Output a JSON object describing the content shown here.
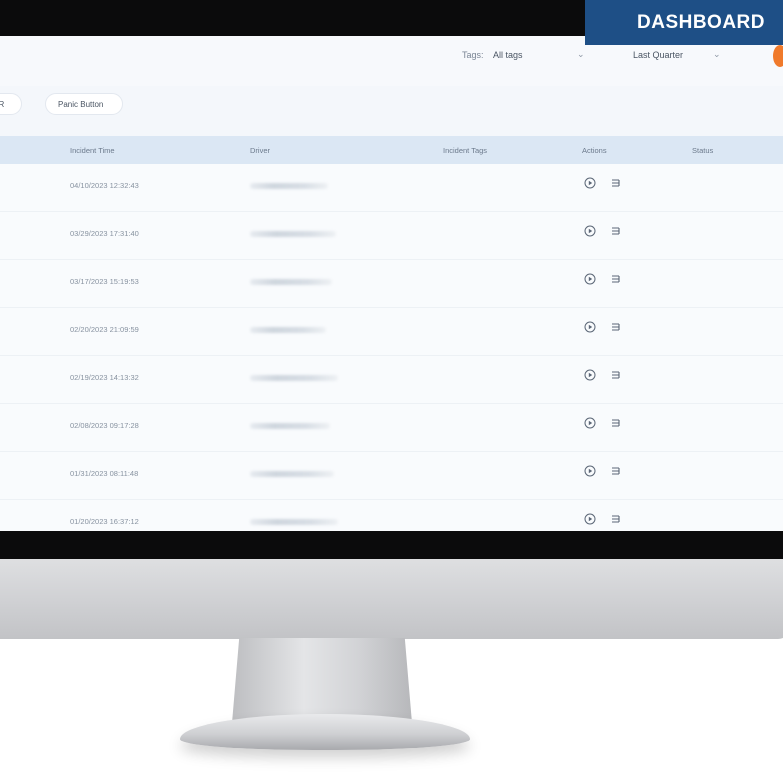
{
  "banner": {
    "title": "DASHBOARD"
  },
  "toolbar": {
    "tags_label": "Tags:",
    "tags_value": "All tags",
    "period_value": "Last Quarter"
  },
  "filters": {
    "chips": [
      "WR",
      "Panic Button"
    ]
  },
  "table": {
    "headers": {
      "incident_time": "Incident Time",
      "driver": "Driver",
      "incident_tags": "Incident Tags",
      "actions": "Actions",
      "status": "Status"
    },
    "rows": [
      {
        "time": "04/10/2023 12:32:43"
      },
      {
        "time": "03/29/2023 17:31:40"
      },
      {
        "time": "03/17/2023 15:19:53"
      },
      {
        "time": "02/20/2023 21:09:59"
      },
      {
        "time": "02/19/2023 14:13:32"
      },
      {
        "time": "02/08/2023 09:17:28"
      },
      {
        "time": "01/31/2023 08:11:48"
      },
      {
        "time": "01/20/2023 16:37:12"
      }
    ]
  },
  "icons": {
    "play": "play-circle-icon",
    "list": "details-list-icon",
    "chevron": "chevron-down-icon"
  },
  "colors": {
    "accent": "#1e4f86",
    "header_row": "#dbe7f4",
    "avatar": "#f07a2b"
  }
}
